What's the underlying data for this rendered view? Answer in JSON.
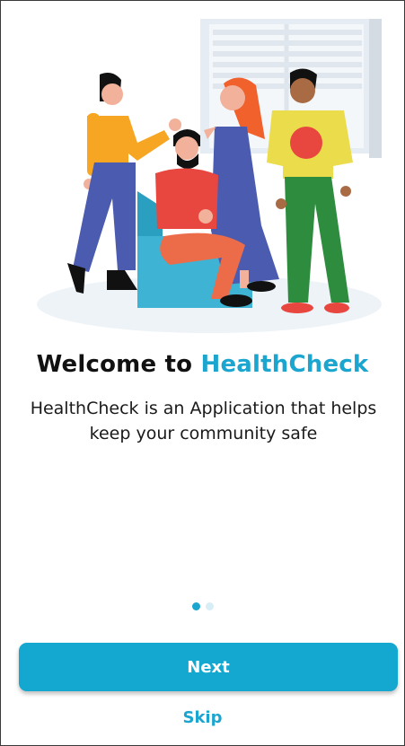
{
  "onboarding": {
    "title_prefix": "Welcome to ",
    "title_brand": "HealthCheck",
    "description": "HealthCheck is an Application that helps keep your community safe",
    "pagination": {
      "total": 2,
      "current": 1
    },
    "next_label": "Next",
    "skip_label": "Skip",
    "illustration": "group-of-people-illustration"
  },
  "colors": {
    "accent": "#1ba5cf",
    "button": "#14a7cf",
    "dot_inactive": "#d7eef6"
  }
}
